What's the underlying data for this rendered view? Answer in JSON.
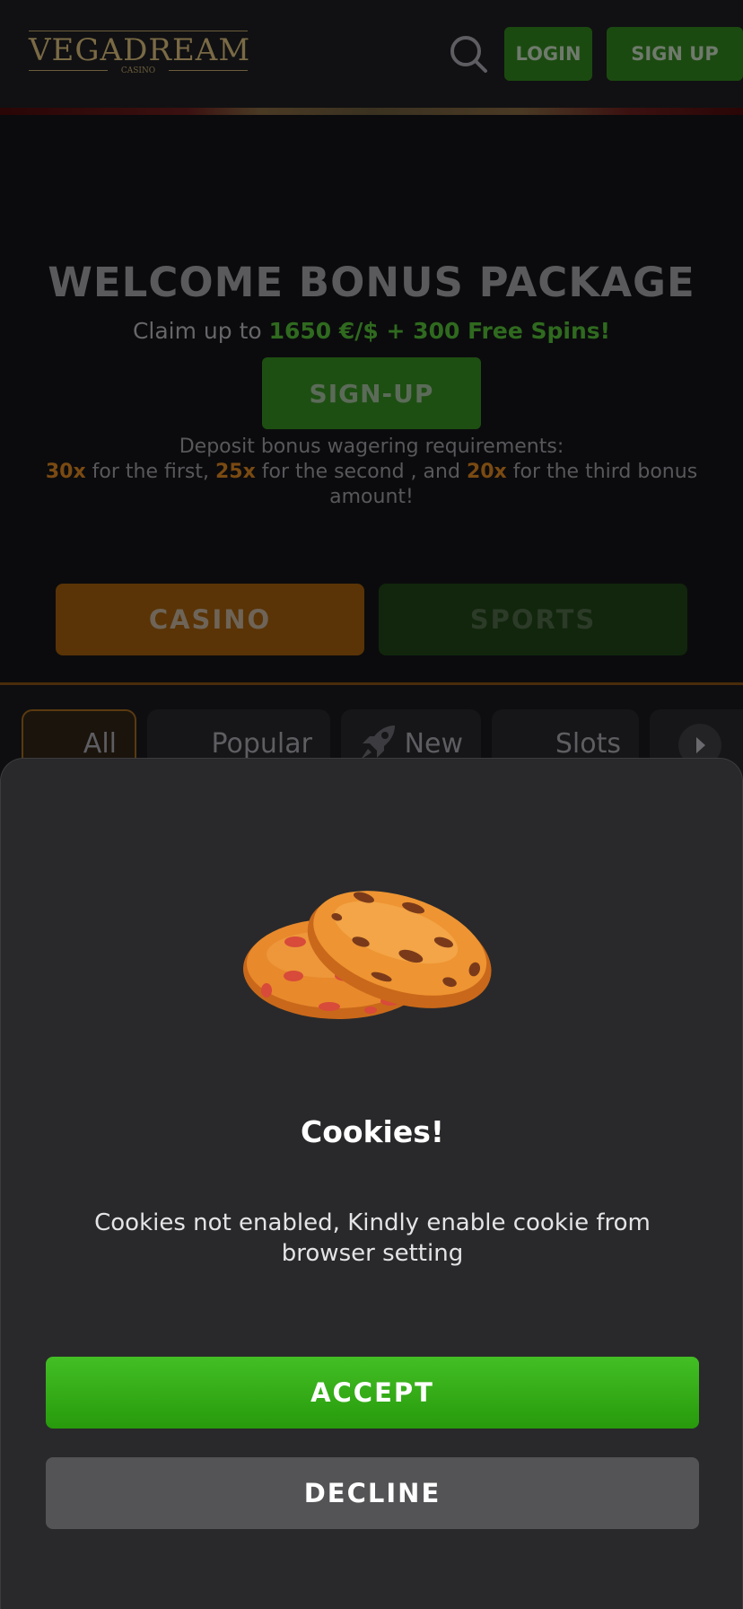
{
  "header": {
    "logo_text": "VEGADREAM",
    "logo_sub": "CASINO",
    "login_label": "LOGIN",
    "signup_label": "SIGN UP"
  },
  "hero": {
    "title": "WELCOME BONUS PACKAGE",
    "claim_prefix": "Claim up to ",
    "claim_highlight": "1650 €/$ + 300 Free Spins!",
    "signup_label": "SIGN-UP",
    "wager_line1": "Deposit bonus wagering requirements:",
    "wager_m1": "30x",
    "wager_t1": " for the first, ",
    "wager_m2": "25x",
    "wager_t2": " for the second , and ",
    "wager_m3": "20x",
    "wager_t3": " for the third bonus amount!",
    "tab_casino": "CASINO",
    "tab_sports": "SPORTS"
  },
  "categories": [
    {
      "label": "All",
      "icon": "star-icon"
    },
    {
      "label": "Popular",
      "icon": "fire-icon"
    },
    {
      "label": "New",
      "icon": "rocket-icon"
    },
    {
      "label": "Slots",
      "icon": "slot-icon"
    }
  ],
  "cookie_modal": {
    "icon": "cookie-icon",
    "title": "Cookies!",
    "message": "Cookies not enabled, Kindly enable cookie from browser setting",
    "accept_label": "ACCEPT",
    "decline_label": "DECLINE"
  },
  "colors": {
    "accent_green": "#2ea614",
    "accent_orange": "#e07a10",
    "modal_bg": "#29292b"
  }
}
